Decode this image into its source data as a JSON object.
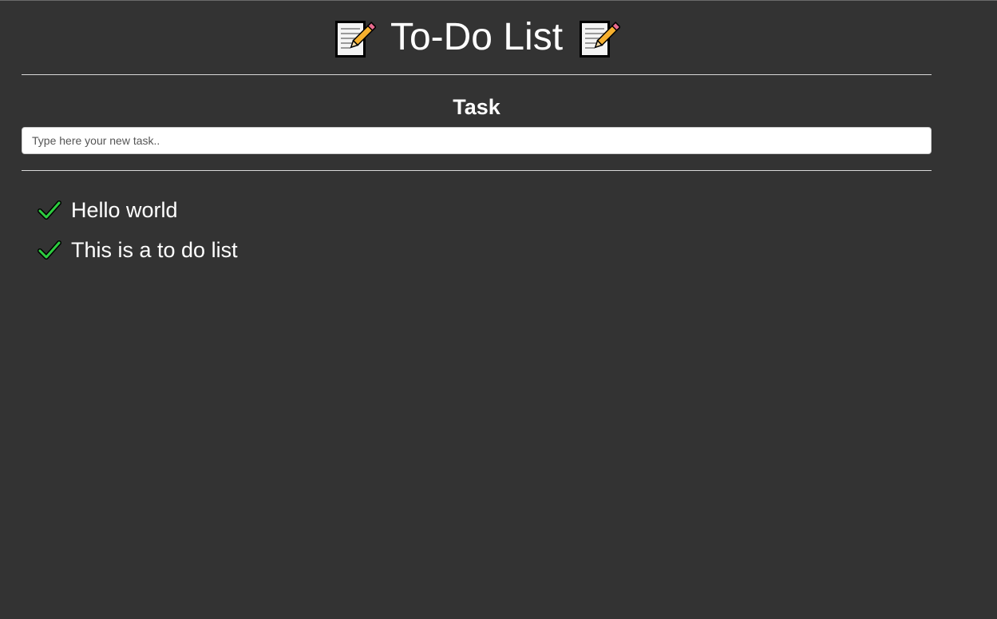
{
  "header": {
    "title": "To-Do List",
    "left_icon": "memo-icon",
    "right_icon": "memo-icon"
  },
  "form": {
    "label": "Task",
    "input_placeholder": "Type here your new task..",
    "input_value": ""
  },
  "tasks": [
    {
      "text": "Hello world",
      "icon": "check-icon",
      "done": true
    },
    {
      "text": "This is a to do list",
      "icon": "check-icon",
      "done": true
    }
  ],
  "colors": {
    "background": "#333333",
    "text": "#ffffff",
    "check": "#2ecc40",
    "divider": "#d8d8d8"
  }
}
